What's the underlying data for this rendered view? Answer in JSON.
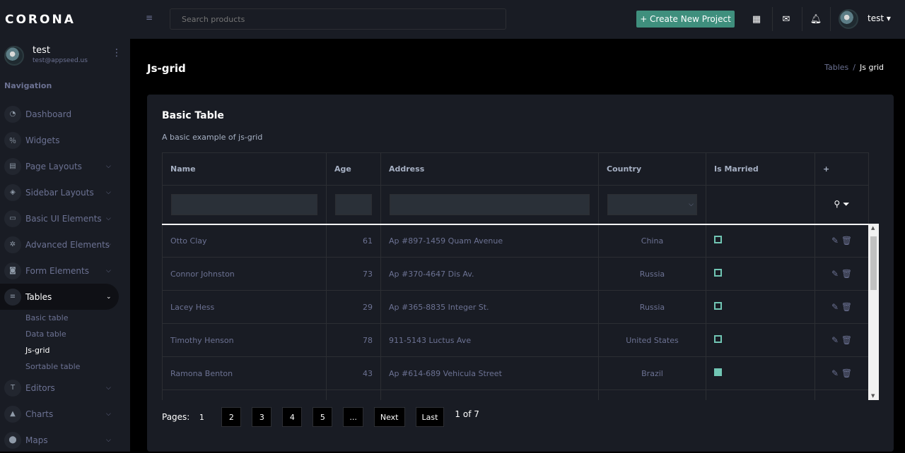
{
  "brand": "CORONA",
  "profile": {
    "name": "test",
    "email": "test@appseed.us"
  },
  "nav_caption": "Navigation",
  "menu": [
    {
      "label": "Dashboard",
      "icon": "speedometer-icon",
      "glyph": "◔"
    },
    {
      "label": "Widgets",
      "icon": "widgets-icon",
      "glyph": "％"
    },
    {
      "label": "Page Layouts",
      "icon": "layout-icon",
      "glyph": "▤"
    },
    {
      "label": "Sidebar Layouts",
      "icon": "sidebar-icon",
      "glyph": "◈"
    },
    {
      "label": "Basic UI Elements",
      "icon": "laptop-icon",
      "glyph": "▭"
    },
    {
      "label": "Advanced Elements",
      "icon": "gear-icon",
      "glyph": "✲"
    },
    {
      "label": "Form Elements",
      "icon": "form-icon",
      "glyph": "◙"
    },
    {
      "label": "Tables",
      "icon": "table-icon",
      "glyph": "≡"
    },
    {
      "label": "Editors",
      "icon": "editor-icon",
      "glyph": "T"
    },
    {
      "label": "Charts",
      "icon": "chart-icon",
      "glyph": "▲"
    },
    {
      "label": "Maps",
      "icon": "map-marker-icon",
      "glyph": "⬤"
    }
  ],
  "submenu": [
    "Basic table",
    "Data table",
    "Js-grid",
    "Sortable table"
  ],
  "navbar": {
    "search_placeholder": "Search products",
    "create_label": "+ Create New Project",
    "user": "test ▾"
  },
  "page": {
    "title": "Js-grid",
    "bc_parent": "Tables",
    "bc_current": "Js grid"
  },
  "card": {
    "title": "Basic Table",
    "desc": "A basic example of js-grid"
  },
  "grid": {
    "headers": [
      "Name",
      "Age",
      "Address",
      "Country",
      "Is Married"
    ],
    "rows": [
      {
        "name": "Otto Clay",
        "age": "61",
        "address": "Ap #897-1459 Quam Avenue",
        "country": "China",
        "married": false
      },
      {
        "name": "Connor Johnston",
        "age": "73",
        "address": "Ap #370-4647 Dis Av.",
        "country": "Russia",
        "married": false
      },
      {
        "name": "Lacey Hess",
        "age": "29",
        "address": "Ap #365-8835 Integer St.",
        "country": "Russia",
        "married": false
      },
      {
        "name": "Timothy Henson",
        "age": "78",
        "address": "911-5143 Luctus Ave",
        "country": "United States",
        "married": false
      },
      {
        "name": "Ramona Benton",
        "age": "43",
        "address": "Ap #614-689 Vehicula Street",
        "country": "Brazil",
        "married": true
      },
      {
        "name": "",
        "age": "",
        "address": "",
        "country": "",
        "married": true
      }
    ]
  },
  "pager": {
    "label": "Pages:",
    "pages": [
      "1",
      "2",
      "3",
      "4",
      "5",
      "..."
    ],
    "next": "Next",
    "last": "Last",
    "info": "1 of 7"
  },
  "colors": {
    "accent": "#3f8f7d",
    "check": "#71c6b4",
    "sidebar": "#191c24"
  }
}
